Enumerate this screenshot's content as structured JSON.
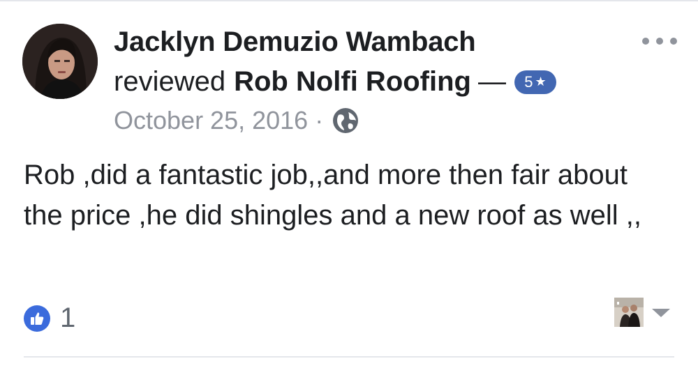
{
  "post": {
    "author_name": "Jacklyn Demuzio Wambach",
    "action_text": "reviewed",
    "page_name": "Rob Nolfi Roofing",
    "separator": "—",
    "rating_value": "5",
    "rating_star": "★",
    "date": "October 25, 2016",
    "date_separator": "·",
    "privacy_icon": "globe-icon",
    "more_icon": "ellipsis-icon"
  },
  "review": {
    "text": "Rob ,did a fantastic job,,and more then fair about the price ,he did shingles and a new roof as well ,,"
  },
  "reactions": {
    "icon": "thumbs-up-icon",
    "count": "1"
  },
  "colors": {
    "text_primary": "#1c1e21",
    "text_secondary": "#90949c",
    "badge_blue": "#4267b2",
    "like_blue": "#3b6bdc"
  }
}
